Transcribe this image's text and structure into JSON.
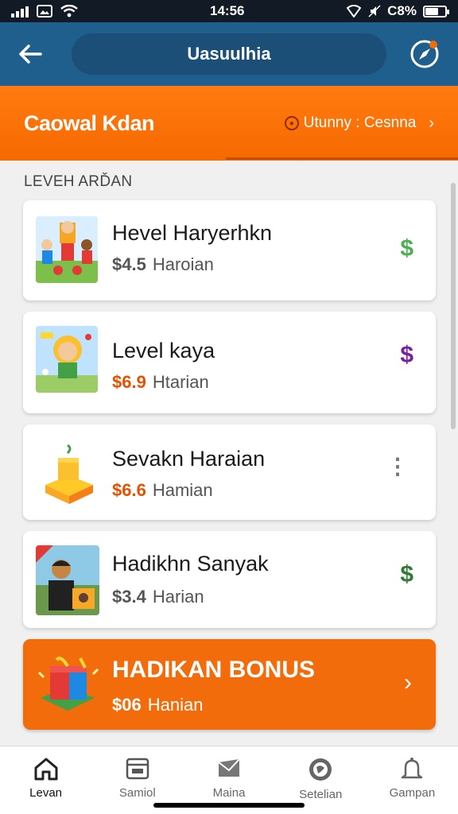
{
  "status_bar": {
    "time": "14:56",
    "battery": "C8%"
  },
  "header": {
    "title": "Uasuulhia"
  },
  "banner": {
    "title": "Caowal Kdan",
    "link_text": "Utunny : Cesnna"
  },
  "section": {
    "label": "LEVEH ARĎAN"
  },
  "items": [
    {
      "name": "Hevel Haryerhkn",
      "amount": "$4.5",
      "period": "Haroian",
      "amount_color": "#555555",
      "trail_icon": "dollar-icon",
      "trail_symbol": "$",
      "trail_color": "#4caf50"
    },
    {
      "name": "Level kaya",
      "amount": "$6.9",
      "period": "Htarian",
      "amount_color": "#e65100",
      "trail_icon": "dollar-icon",
      "trail_symbol": "$",
      "trail_color": "#7b1fa2"
    },
    {
      "name": "Sevakn Haraian",
      "amount": "$6.6",
      "period": "Hamian",
      "amount_color": "#e65100",
      "trail_icon": "more-icon",
      "trail_symbol": "⋮",
      "trail_color": "#777777"
    },
    {
      "name": "Hadikhn Sanyak",
      "amount": "$3.4",
      "period": "Harian",
      "amount_color": "#555555",
      "trail_icon": "dollar-icon",
      "trail_symbol": "$",
      "trail_color": "#2e7d32"
    }
  ],
  "bonus": {
    "name": "HADIKAN BONUS",
    "amount": "$06",
    "period": "Hanian"
  },
  "nav": [
    {
      "label": "Levan",
      "icon": "home-icon",
      "active": true
    },
    {
      "label": "Samiol",
      "icon": "calendar-icon",
      "active": false
    },
    {
      "label": "Maina",
      "icon": "envelope-icon",
      "active": false
    },
    {
      "label": "Setelian",
      "icon": "globe-icon",
      "active": false
    },
    {
      "label": "Gampan",
      "icon": "bell-icon",
      "active": false
    }
  ],
  "colors": {
    "header": "#1f5f8e",
    "accent": "#f66a00",
    "bonus": "#f36c0b"
  }
}
